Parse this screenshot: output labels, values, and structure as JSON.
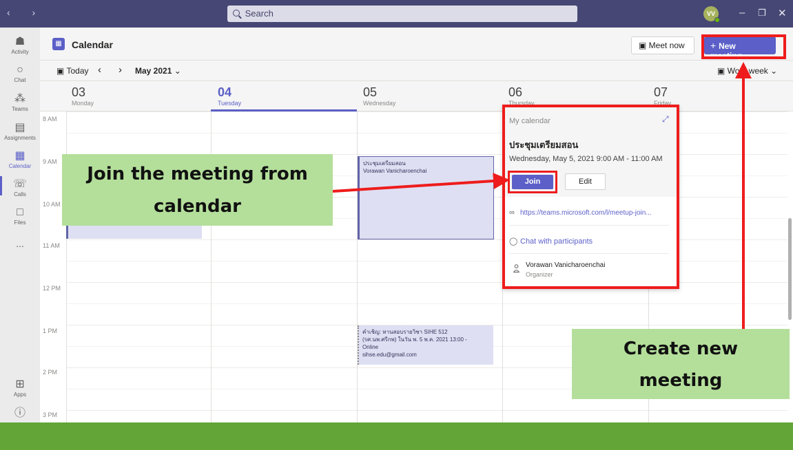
{
  "titlebar": {
    "search_placeholder": "Search",
    "avatar_initials": "VV"
  },
  "rail": {
    "items": [
      {
        "label": "Activity",
        "icon": "bell-icon"
      },
      {
        "label": "Chat",
        "icon": "chat-icon"
      },
      {
        "label": "Teams",
        "icon": "teams-icon"
      },
      {
        "label": "Assignments",
        "icon": "assignments-icon"
      },
      {
        "label": "Calendar",
        "icon": "calendar-icon",
        "active": true
      },
      {
        "label": "Calls",
        "icon": "phone-icon"
      },
      {
        "label": "Files",
        "icon": "file-icon"
      },
      {
        "label": "...",
        "icon": "more-icon"
      },
      {
        "label": "Apps",
        "icon": "apps-icon"
      },
      {
        "label": "Help",
        "icon": "help-icon"
      }
    ]
  },
  "header": {
    "title": "Calendar",
    "meet_now": "Meet now",
    "new_meeting": "New meeting"
  },
  "toolbar": {
    "today": "Today",
    "month": "May 2021",
    "view": "Work week"
  },
  "days": [
    {
      "num": "03",
      "name": "Monday"
    },
    {
      "num": "04",
      "name": "Tuesday",
      "today": true
    },
    {
      "num": "05",
      "name": "Wednesday"
    },
    {
      "num": "06",
      "name": "Thursday"
    },
    {
      "num": "07",
      "name": "Friday"
    }
  ],
  "hours": [
    "8 AM",
    "9 AM",
    "10 AM",
    "11 AM",
    "12 PM",
    "1 PM",
    "2 PM",
    "3 PM"
  ],
  "events": {
    "meeting": {
      "title": "ประชุมเตรียมสอน",
      "organizer": "Vorawan Vanicharoenchai"
    },
    "invite": {
      "line1": "คำเชิญ: หานสอบรายวิชา SIHE 512",
      "line2": "(รศ.นพ.ศรีกพ) ในวัน พ. 5 พ.ค. 2021 13:00 -",
      "line3": "Online",
      "line4": "sihse.edu@gmail.com"
    }
  },
  "popup": {
    "calendar": "My calendar",
    "title": "ประชุมเตรียมสอน",
    "time": "Wednesday, May 5, 2021 9:00 AM - 11:00 AM",
    "join": "Join",
    "edit": "Edit",
    "link": "https://teams.microsoft.com/l/meetup-join...",
    "chat": "Chat with participants",
    "organizer": "Vorawan Vanicharoenchai",
    "organizer_role": "Organizer"
  },
  "annotations": {
    "join_callout_line1": "Join the meeting from",
    "join_callout_line2": "calendar",
    "create_callout_line1": "Create new",
    "create_callout_line2": "meeting",
    "accent_color": "#ee1c1c",
    "callout_color": "#b4df9b"
  }
}
